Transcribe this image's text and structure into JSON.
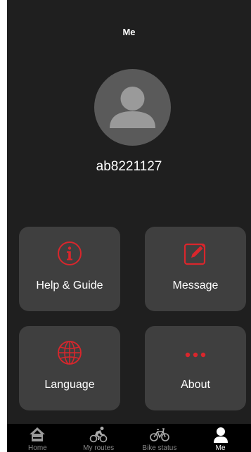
{
  "header": {
    "title": "Me"
  },
  "profile": {
    "username": "ab8221127"
  },
  "tiles": {
    "help": {
      "label": "Help & Guide",
      "icon": "info-icon"
    },
    "message": {
      "label": "Message",
      "icon": "edit-icon"
    },
    "language": {
      "label": "Language",
      "icon": "globe-icon"
    },
    "about": {
      "label": "About",
      "icon": "more-dots-icon"
    }
  },
  "tabbar": {
    "items": [
      {
        "label": "Home",
        "icon": "home-icon"
      },
      {
        "label": "My routes",
        "icon": "cyclist-icon"
      },
      {
        "label": "Bike status",
        "icon": "bike-icon"
      },
      {
        "label": "Me",
        "icon": "person-icon",
        "active": true
      }
    ]
  },
  "colors": {
    "accent": "#d9262c",
    "background": "#1f1f1f",
    "tile": "#3f3f3f",
    "tabbar": "#000000"
  }
}
